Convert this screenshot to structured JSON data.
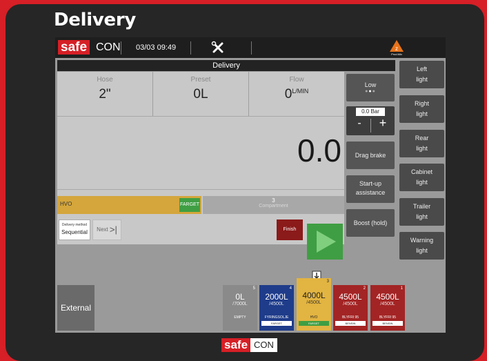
{
  "page_title": "Delivery",
  "topbar": {
    "logo_safe": "safe",
    "logo_con": "CON",
    "datetime": "03/03 09:49",
    "tools_icon": "wrench-screwdriver-icon",
    "prodmix_label": "Prod.Mix"
  },
  "delivery_header": "Delivery",
  "info": {
    "hose_label": "Hose",
    "hose_value": "2\"",
    "preset_label": "Preset",
    "preset_value": "0L",
    "flow_label": "Flow",
    "flow_value": "0",
    "flow_unit": "L/MIN"
  },
  "counter": "0.0",
  "product": {
    "name": "HVO",
    "tag": "FARGET"
  },
  "compartment": {
    "number": "3",
    "label": "Compartment"
  },
  "method": {
    "label": "Delivery method",
    "value": "Sequential"
  },
  "next_label": "Next",
  "finish_label": "Finish",
  "controls": {
    "low_label": "Low",
    "pressure_label": "0.0 Bar",
    "minus": "-",
    "plus": "+",
    "drag_brake": "Drag brake",
    "startup_line1": "Start-up",
    "startup_line2": "assistance",
    "boost": "Boost (hold)"
  },
  "lights": [
    {
      "l1": "Left",
      "l2": "light"
    },
    {
      "l1": "Right",
      "l2": "light"
    },
    {
      "l1": "Rear",
      "l2": "light"
    },
    {
      "l1": "Cabinet",
      "l2": "light"
    },
    {
      "l1": "Trailer",
      "l2": "light"
    },
    {
      "l1": "Warning",
      "l2": "light"
    }
  ],
  "external_label": "External",
  "tanks": [
    {
      "num": "5",
      "level": "0L",
      "cap": "/7000L",
      "prod": "EMPTY",
      "tag": "",
      "color": "#8a8a8a"
    },
    {
      "num": "4",
      "level": "2000L",
      "cap": "/4500L",
      "prod": "FYRINGSOLJE",
      "tag": "FARGET",
      "color": "#1f3c8a"
    },
    {
      "num": "3",
      "level": "4000L",
      "cap": "/4500L",
      "prod": "HVO",
      "tag": "FARGET",
      "color": "#e2b441"
    },
    {
      "num": "2",
      "level": "4500L",
      "cap": "/4500L",
      "prod": "BLYFRI 95",
      "tag": "BENSIN",
      "color": "#a32424"
    },
    {
      "num": "1",
      "level": "4500L",
      "cap": "/4500L",
      "prod": "BLYFRI 95",
      "tag": "BENSIN",
      "color": "#a32424"
    }
  ],
  "footer": {
    "safe": "safe",
    "con": "CON"
  },
  "colors": {
    "brand": "#d61f26",
    "start": "#3f9e43",
    "finish": "#8b1a1a"
  }
}
